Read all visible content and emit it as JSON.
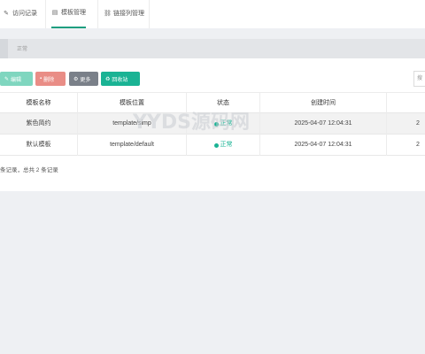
{
  "tabs": [
    {
      "label": "访问记录",
      "icon": "pencil-icon"
    },
    {
      "label": "模板管理",
      "icon": "table-icon"
    },
    {
      "label": "链接列管理",
      "icon": "link-icon"
    }
  ],
  "filter": {
    "label": "正常"
  },
  "toolbar": {
    "edit_label": "编辑",
    "delete_label": "删除",
    "more_label": "更多",
    "recycle_label": "回收站"
  },
  "search": {
    "placeholder": "搜"
  },
  "table": {
    "columns": [
      "模板名称",
      "模板位置",
      "状态",
      "创建时间"
    ],
    "rows": [
      {
        "name": "紫色简约",
        "location": "template/simp",
        "status": "正常",
        "created": "2025-04-07 12:04:31",
        "extra": "2"
      },
      {
        "name": "默认模板",
        "location": "template/default",
        "status": "正常",
        "created": "2025-04-07 12:04:31",
        "extra": "2"
      }
    ]
  },
  "footer": {
    "summary": "条记录，总共 2 条记录"
  },
  "watermark": {
    "text": "YYDS源码网"
  },
  "colors": {
    "accent": "#1ab394",
    "danger": "#e98d86",
    "muted": "#7a8089"
  }
}
